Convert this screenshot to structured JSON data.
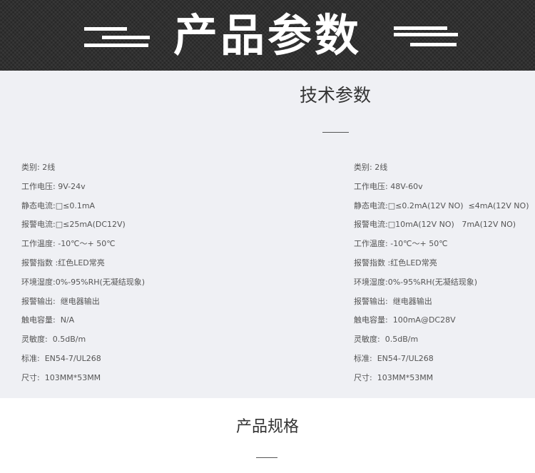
{
  "banner": {
    "title": "产品参数"
  },
  "tech_section": {
    "title": "技术参数"
  },
  "specs_left": [
    {
      "label": "类别",
      "value": "2线"
    },
    {
      "label": "工作电压",
      "value": "9V-24v"
    },
    {
      "label": "静态电流",
      "value": "□≤0.1mA"
    },
    {
      "label": "报警电流",
      "value": "□≤25mA(DC12V)"
    },
    {
      "label": "工作温度",
      "value": "-10℃～+ 50℃"
    },
    {
      "label": "报警指数",
      "value": "红色LED常亮"
    },
    {
      "label": "环境湿度",
      "value": "0%-95%RH(无凝结现象)"
    },
    {
      "label": "报警输出",
      "value": "继电器输出"
    },
    {
      "label": "触电容量",
      "value": "N/A"
    },
    {
      "label": "灵敏度",
      "value": "0.5dB/m"
    },
    {
      "label": "标准",
      "value": "EN54-7/UL268"
    },
    {
      "label": "尺寸",
      "value": "103MM*53MM"
    }
  ],
  "specs_right": [
    {
      "label": "类别",
      "value": "2线"
    },
    {
      "label": "工作电压",
      "value": "48V-60v"
    },
    {
      "label": "静态电流",
      "value": "□≤0.2mA(12V NO)  ≤4mA(12V NO)"
    },
    {
      "label": "报警电流",
      "value": "□10mA(12V NO)   7mA(12V NO)"
    },
    {
      "label": "工作温度",
      "value": "-10℃～+ 50℃"
    },
    {
      "label": "报警指数",
      "value": "红色LED常亮"
    },
    {
      "label": "环境湿度",
      "value": "0%-95%RH(无凝结现象)"
    },
    {
      "label": "报警输出",
      "value": "继电器输出"
    },
    {
      "label": "触电容量",
      "value": "100mA@DC28V"
    },
    {
      "label": "灵敏度",
      "value": "0.5dB/m"
    },
    {
      "label": "标准",
      "value": "EN54-7/UL268"
    },
    {
      "label": "尺寸",
      "value": "103MM*53MM"
    }
  ],
  "spec_separators": {
    "left": [
      ":",
      ":",
      ":",
      ":",
      ":",
      " :",
      ":",
      ":",
      ":",
      ":",
      ":",
      ":"
    ],
    "right": [
      ":",
      ":",
      ":",
      ":",
      ":",
      " :",
      ":",
      ":",
      ":",
      ":",
      ":",
      ":"
    ]
  },
  "product_section": {
    "title": "产品规格"
  },
  "colors": {
    "banner_bg": "#2b2b2b",
    "panel_bg": "#eff0f4",
    "text": "#555555",
    "title": "#333333"
  }
}
